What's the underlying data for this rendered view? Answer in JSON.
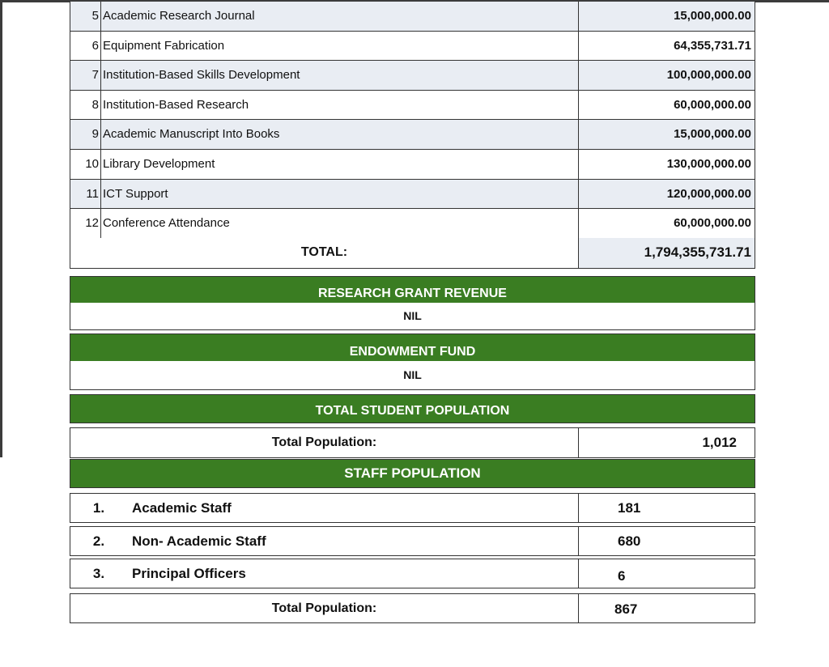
{
  "expenditure_items": [
    {
      "no": "5",
      "name": "Academic Research Journal",
      "amount": "15,000,000.00"
    },
    {
      "no": "6",
      "name": "Equipment Fabrication",
      "amount": "64,355,731.71"
    },
    {
      "no": "7",
      "name": "Institution-Based Skills Development",
      "amount": "100,000,000.00"
    },
    {
      "no": "8",
      "name": "Institution-Based Research",
      "amount": "60,000,000.00"
    },
    {
      "no": "9",
      "name": "Academic Manuscript Into Books",
      "amount": "15,000,000.00"
    },
    {
      "no": "10",
      "name": "Library Development",
      "amount": "130,000,000.00"
    },
    {
      "no": "11",
      "name": "ICT Support",
      "amount": "120,000,000.00"
    },
    {
      "no": "12",
      "name": "Conference Attendance",
      "amount": "60,000,000.00"
    }
  ],
  "total": {
    "label": "TOTAL:",
    "amount": "1,794,355,731.71"
  },
  "research_grant": {
    "title": "RESEARCH GRANT REVENUE",
    "value": "NIL"
  },
  "endowment": {
    "title": "ENDOWMENT FUND",
    "value": "NIL"
  },
  "student_population": {
    "title": "TOTAL STUDENT POPULATION",
    "label": "Total Population:",
    "value": "1,012"
  },
  "staff_population": {
    "title": "STAFF POPULATION",
    "rows": [
      {
        "no": "1.",
        "name": "Academic Staff",
        "value": "181"
      },
      {
        "no": "2.",
        "name": "Non- Academic Staff",
        "value": "680"
      },
      {
        "no": "3.",
        "name": "Principal Officers",
        "value": "6"
      }
    ],
    "total_label": "Total Population:",
    "total_value": "867"
  },
  "colors": {
    "band_green": "#3a7d22",
    "row_shade": "#e9edf3"
  }
}
